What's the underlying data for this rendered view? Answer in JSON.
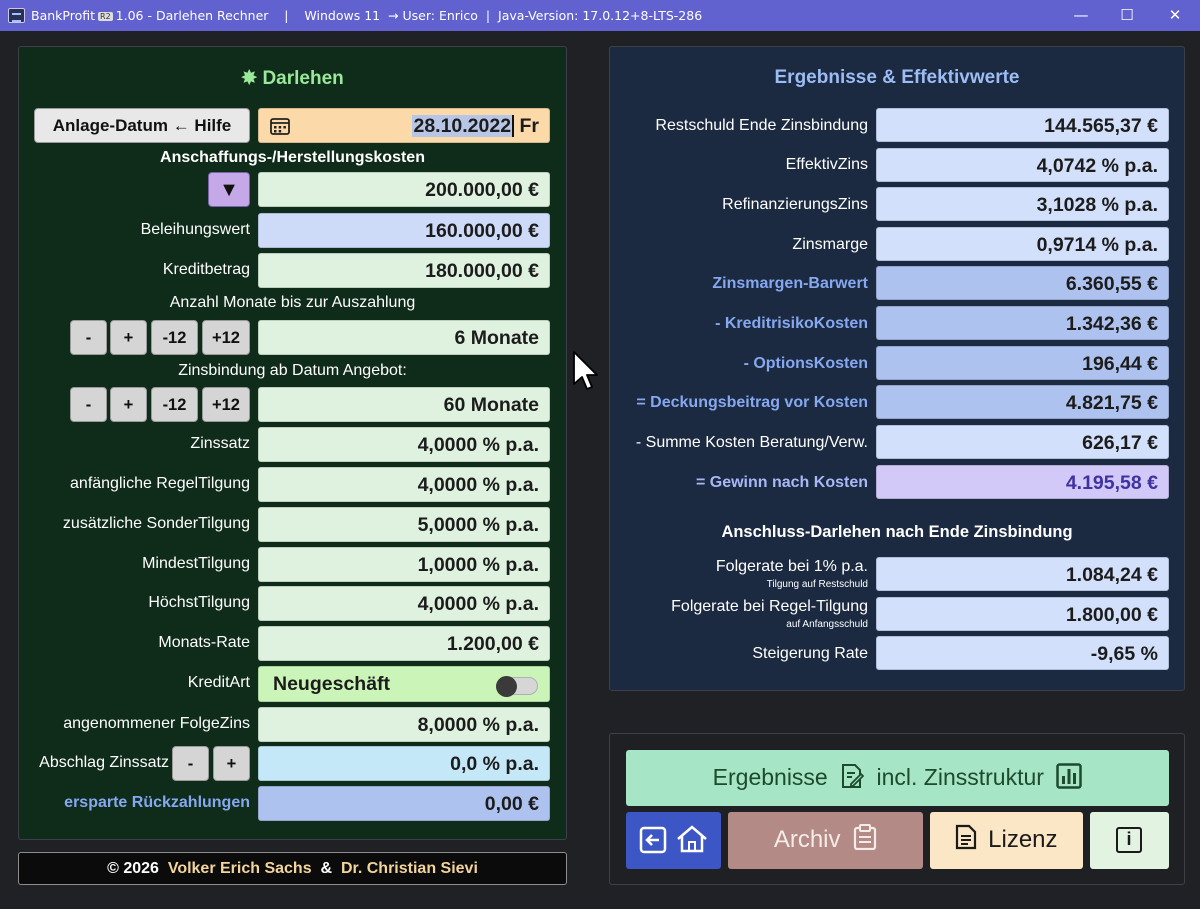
{
  "window": {
    "app_name": "BankProfit",
    "icon_badge": "R2",
    "title_rest": "1.06 - Darlehen Rechner    |    Windows 11  → User: Enrico  |  Java-Version: 17.0.12+8-LTS-286",
    "minimize": "—",
    "maximize": "☐",
    "close": "✕"
  },
  "left": {
    "title_icon": "✸",
    "title": "Darlehen",
    "anlage_button": "Anlage-Datum ← Hilfe",
    "date_value": "28.10.2022",
    "date_weekday": "Fr",
    "anschaffung_header": "Anschaffungs-/Herstellungskosten",
    "dropdown_arrow": "▼",
    "anschaffung_value": "200.000,00 €",
    "beleihungswert_label": "Beleihungswert",
    "beleihungswert_value": "160.000,00 €",
    "kreditbetrag_label": "Kreditbetrag",
    "kreditbetrag_value": "180.000,00 €",
    "monate_header": "Anzahl Monate bis zur Auszahlung",
    "stepper": {
      "minus": "-",
      "plus": "+",
      "minus12": "-12",
      "plus12": "+12"
    },
    "monate_value": "6 Monate",
    "zinsbindung_header": "Zinsbindung ab Datum Angebot:",
    "zinsbindung_value": "60 Monate",
    "zinssatz_label": "Zinssatz",
    "zinssatz_value": "4,0000 % p.a.",
    "regeltilgung_label": "anfängliche RegelTilgung",
    "regeltilgung_value": "4,0000 % p.a.",
    "sondertilgung_label": "zusätzliche SonderTilgung",
    "sondertilgung_value": "5,0000 % p.a.",
    "mindesttilgung_label": "MindestTilgung",
    "mindesttilgung_value": "1,0000 % p.a.",
    "hoechsttilgung_label": "HöchstTilgung",
    "hoechsttilgung_value": "4,0000 % p.a.",
    "monatsrate_label": "Monats-Rate",
    "monatsrate_value": "1.200,00 €",
    "kreditart_label": "KreditArt",
    "kreditart_value": "Neugeschäft",
    "folgezins_label": "angenommener FolgeZins",
    "folgezins_value": "8,0000 % p.a.",
    "abschlag_label": "Abschlag Zinssatz",
    "abschlag_value": "0,0 % p.a.",
    "ersparte_label": "ersparte Rückzahlungen",
    "ersparte_value": "0,00 €"
  },
  "right": {
    "title": "Ergebnisse & Effektivwerte",
    "rows": [
      {
        "label": "Restschuld Ende Zinsbindung",
        "value": "144.565,37 €"
      },
      {
        "label": "EffektivZins",
        "value": "4,0742 % p.a."
      },
      {
        "label": "RefinanzierungsZins",
        "value": "3,1028 % p.a."
      },
      {
        "label": "Zinsmarge",
        "value": "0,9714 % p.a."
      },
      {
        "label": "Zinsmargen-Barwert",
        "value": "6.360,55 €"
      },
      {
        "label": "- KreditrisikoKosten",
        "value": "1.342,36 €"
      },
      {
        "label": "- OptionsKosten",
        "value": "196,44 €"
      },
      {
        "label": "= Deckungsbeitrag vor Kosten",
        "value": "4.821,75 €"
      },
      {
        "label": "- Summe Kosten Beratung/Verw.",
        "value": "626,17 €"
      },
      {
        "label": "= Gewinn nach Kosten",
        "value": "4.195,58 €"
      }
    ],
    "anschluss_title": "Anschluss-Darlehen nach Ende Zinsbindung",
    "folgerate1_label": "Folgerate bei 1% p.a.",
    "folgerate1_sub": "Tilgung auf Restschuld",
    "folgerate1_value": "1.084,24 €",
    "folgerate2_label": "Folgerate bei Regel-Tilgung",
    "folgerate2_sub": "auf Anfangsschuld",
    "folgerate2_value": "1.800,00 €",
    "steigerung_label": "Steigerung Rate",
    "steigerung_value": "-9,65 %"
  },
  "buttons": {
    "ergebnisse_a": "Ergebnisse",
    "ergebnisse_b": "incl. Zinsstruktur",
    "archiv": "Archiv",
    "lizenz": "Lizenz",
    "info": "i"
  },
  "footer": {
    "copyright": "© 2026",
    "author1": "Volker Erich Sachs",
    "amp": "&",
    "author2": "Dr. Christian Sievi"
  }
}
